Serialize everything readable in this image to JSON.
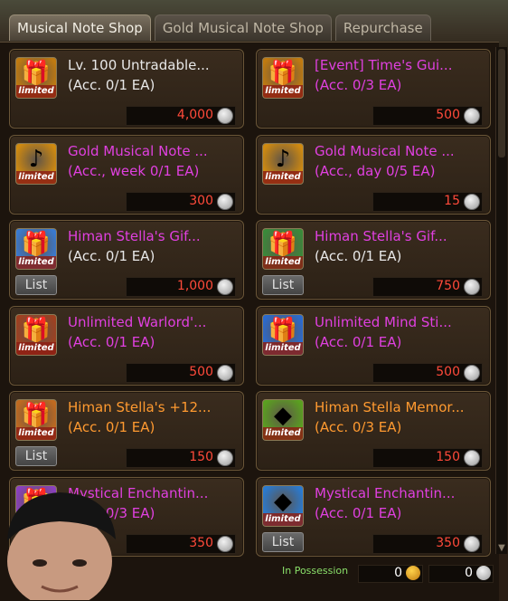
{
  "tabs": [
    "Musical Note Shop",
    "Gold Musical Note Shop",
    "Repurchase"
  ],
  "items": [
    {
      "name": "Lv. 100 Untradable...",
      "limit": "(Acc. 0/1 EA)",
      "price": "4,000",
      "name_color": "#e8e8e8",
      "limit_color": "#e8e8e8",
      "icon": "gold-box-icon",
      "icon_bg": "#c07a10",
      "glyph": "🎁",
      "limited": "limited",
      "list": ""
    },
    {
      "name": "[Event] Time's Gui...",
      "limit": "(Acc. 0/3 EA)",
      "price": "500",
      "name_color": "#e040e0",
      "limit_color": "#e040e0",
      "icon": "gold-chest-icon",
      "icon_bg": "#c07a10",
      "glyph": "🎁",
      "limited": "limited",
      "list": ""
    },
    {
      "name": "Gold Musical Note ...",
      "limit": "(Acc., week 0/1 EA)",
      "price": "300",
      "name_color": "#e040e0",
      "limit_color": "#e040e0",
      "icon": "gold-note-coin-icon",
      "icon_bg": "#d08a10",
      "glyph": "♪",
      "limited": "limited",
      "list": ""
    },
    {
      "name": "Gold Musical Note ...",
      "limit": "(Acc., day 0/5 EA)",
      "price": "15",
      "name_color": "#e040e0",
      "limit_color": "#e040e0",
      "icon": "gold-note-coin-icon",
      "icon_bg": "#d08a10",
      "glyph": "♪",
      "limited": "limited",
      "list": ""
    },
    {
      "name": "Himan Stella's Gif...",
      "limit": "(Acc. 0/1 EA)",
      "price": "1,000",
      "name_color": "#e040e0",
      "limit_color": "#e8e8e8",
      "icon": "blue-gift-icon",
      "icon_bg": "#3a7ad0",
      "glyph": "🎁",
      "limited": "limited",
      "list": "List"
    },
    {
      "name": "Himan Stella's Gif...",
      "limit": "(Acc. 0/1 EA)",
      "price": "750",
      "name_color": "#e040e0",
      "limit_color": "#e8e8e8",
      "icon": "red-gift-icon",
      "icon_bg": "#3a8a3a",
      "glyph": "🎁",
      "limited": "limited",
      "list": "List"
    },
    {
      "name": "Unlimited Warlord'...",
      "limit": "(Acc. 0/1 EA)",
      "price": "500",
      "name_color": "#e040e0",
      "limit_color": "#e040e0",
      "icon": "warlord-box-icon",
      "icon_bg": "#a04020",
      "glyph": "🎁",
      "limited": "limited",
      "list": ""
    },
    {
      "name": "Unlimited Mind Sti...",
      "limit": "(Acc. 0/1 EA)",
      "price": "500",
      "name_color": "#e040e0",
      "limit_color": "#e040e0",
      "icon": "mind-box-icon",
      "icon_bg": "#2a6ad0",
      "glyph": "🎁",
      "limited": "limited",
      "list": ""
    },
    {
      "name": "Himan Stella's +12...",
      "limit": "(Acc. 0/1 EA)",
      "price": "150",
      "name_color": "#ff9a30",
      "limit_color": "#ff9a30",
      "icon": "enhance-box-icon",
      "icon_bg": "#c06a20",
      "glyph": "🎁",
      "limited": "limited",
      "list": "List"
    },
    {
      "name": "Himan Stella Memor...",
      "limit": "(Acc. 0/3 EA)",
      "price": "150",
      "name_color": "#ff9a30",
      "limit_color": "#ff9a30",
      "icon": "green-crystal-icon",
      "icon_bg": "#5aa020",
      "glyph": "◆",
      "limited": "limited",
      "list": ""
    },
    {
      "name": "Mystical Enchantin...",
      "limit": "(Acc. 0/3 EA)",
      "price": "350",
      "name_color": "#e040e0",
      "limit_color": "#e040e0",
      "icon": "mystic-box-icon",
      "icon_bg": "#8a40c0",
      "glyph": "🎁",
      "limited": "limited",
      "list": ""
    },
    {
      "name": "Mystical Enchantin...",
      "limit": "(Acc. 0/1 EA)",
      "price": "350",
      "name_color": "#e040e0",
      "limit_color": "#e040e0",
      "icon": "blue-crystal-box-icon",
      "icon_bg": "#2a7ad0",
      "glyph": "◆",
      "limited": "limited",
      "list": "List"
    }
  ],
  "possession": {
    "label": "In Possession",
    "musical_notes": "0",
    "gold_notes": "0"
  }
}
